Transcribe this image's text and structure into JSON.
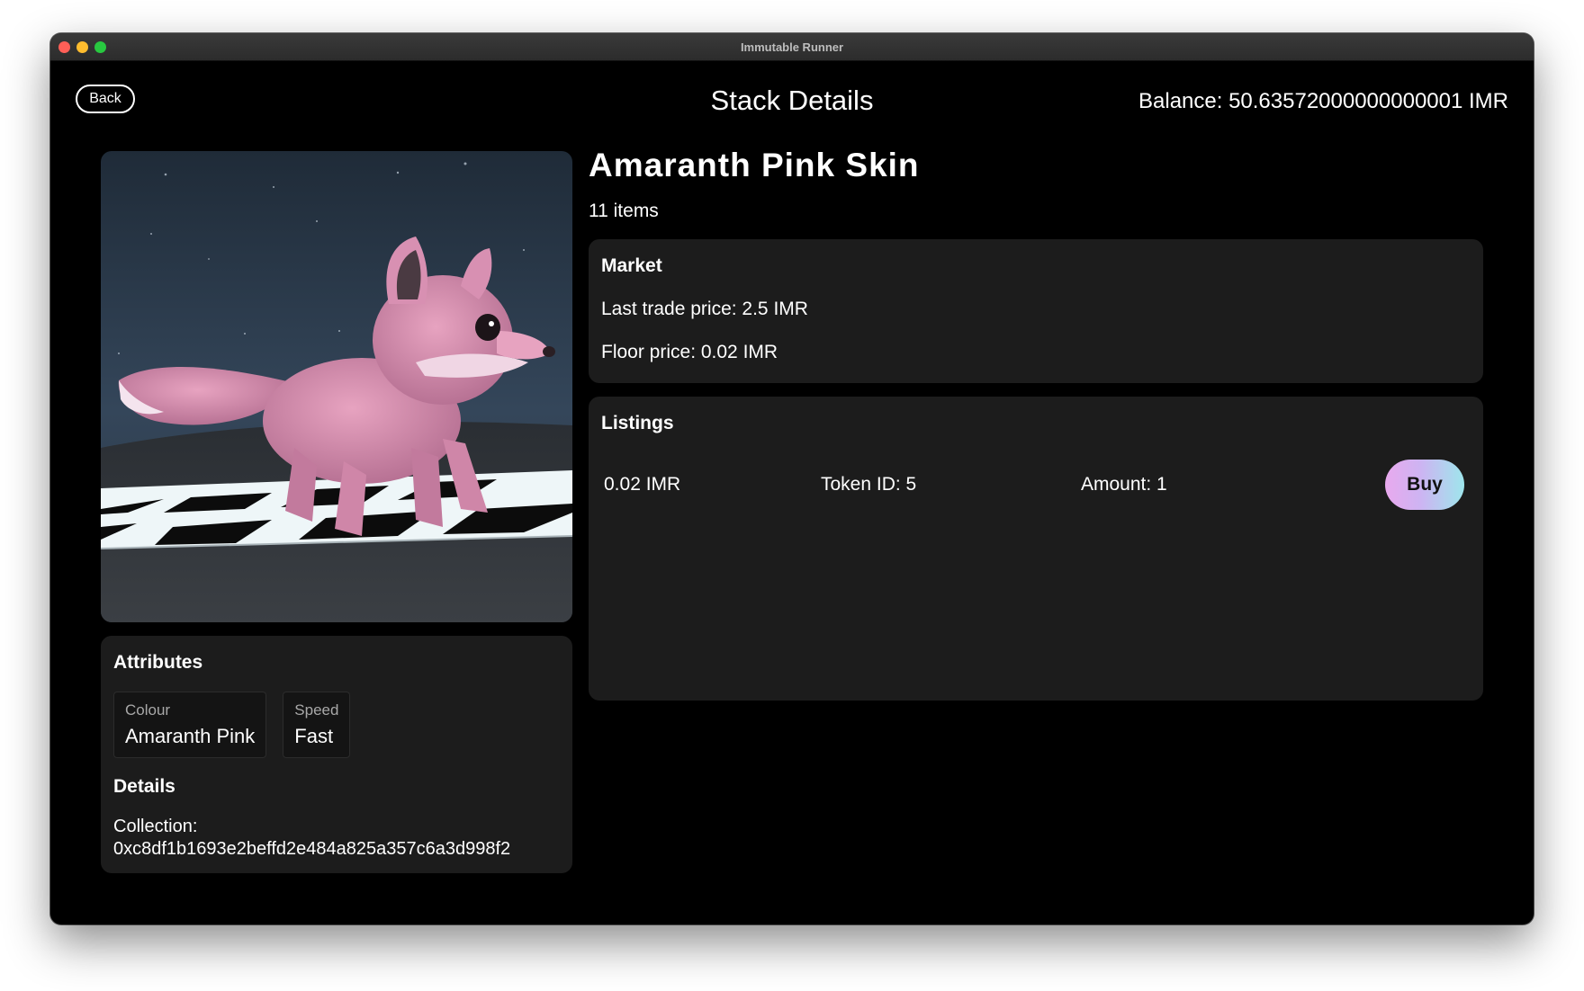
{
  "window": {
    "title": "Immutable Runner"
  },
  "header": {
    "back_label": "Back",
    "page_title": "Stack Details",
    "balance": "Balance: 50.63572000000000001 IMR"
  },
  "item": {
    "name": "Amaranth Pink Skin",
    "count": "11 items",
    "image": "pink-fox-character-on-checkered-floor"
  },
  "attributes": {
    "heading": "Attributes",
    "items": [
      {
        "label": "Colour",
        "value": "Amaranth Pink"
      },
      {
        "label": "Speed",
        "value": "Fast"
      }
    ]
  },
  "details": {
    "heading": "Details",
    "collection_label": "Collection:",
    "collection_address": "0xc8df1b1693e2beffd2e484a825a357c6a3d998f2"
  },
  "market": {
    "heading": "Market",
    "last_trade": "Last trade price: 2.5 IMR",
    "floor": "Floor price: 0.02 IMR"
  },
  "listings": {
    "heading": "Listings",
    "rows": [
      {
        "price": "0.02 IMR",
        "token": "Token ID: 5",
        "amount": "Amount: 1",
        "action": "Buy"
      }
    ]
  },
  "colors": {
    "background": "#000000",
    "panel": "#1c1c1c",
    "buy_gradient_start": "#e9a9ee",
    "buy_gradient_end": "#9ee6ec"
  }
}
